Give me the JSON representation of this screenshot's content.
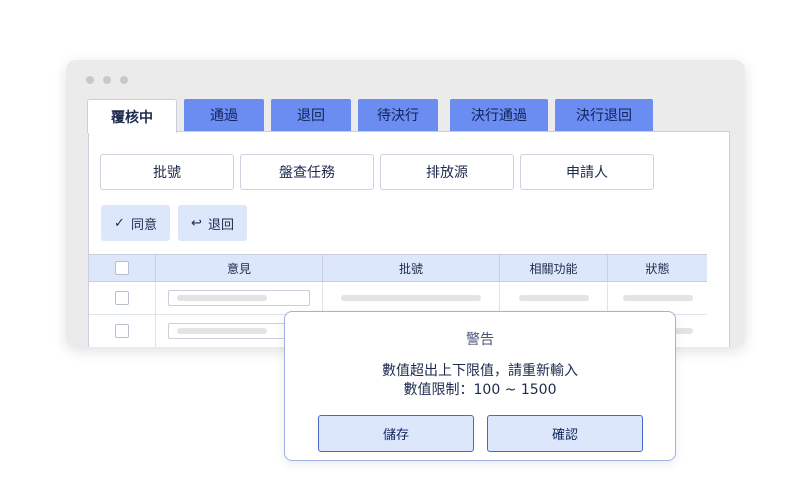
{
  "tabs": [
    {
      "label": "覆核中",
      "active": true
    },
    {
      "label": "通過",
      "active": false
    },
    {
      "label": "退回",
      "active": false
    },
    {
      "label": "待決行",
      "active": false
    },
    {
      "label": "決行通過",
      "active": false
    },
    {
      "label": "決行退回",
      "active": false
    }
  ],
  "filters": [
    "批號",
    "盤查任務",
    "排放源",
    "申請人"
  ],
  "actions": {
    "approve": {
      "label": "同意",
      "icon": "check-icon"
    },
    "reject": {
      "label": "退回",
      "icon": "return-arrow-icon"
    }
  },
  "table": {
    "columns": [
      "",
      "意見",
      "批號",
      "相關功能",
      "狀態"
    ]
  },
  "dialog": {
    "title": "警告",
    "message_line1": "數值超出上下限值，請重新輸入",
    "message_line2": "數值限制：100 ~ 1500",
    "save_label": "儲存",
    "confirm_label": "確認"
  },
  "colors": {
    "tab_inactive": "#6b8cf0",
    "accent_light": "#dde7fb",
    "dialog_border": "#4967c9"
  }
}
